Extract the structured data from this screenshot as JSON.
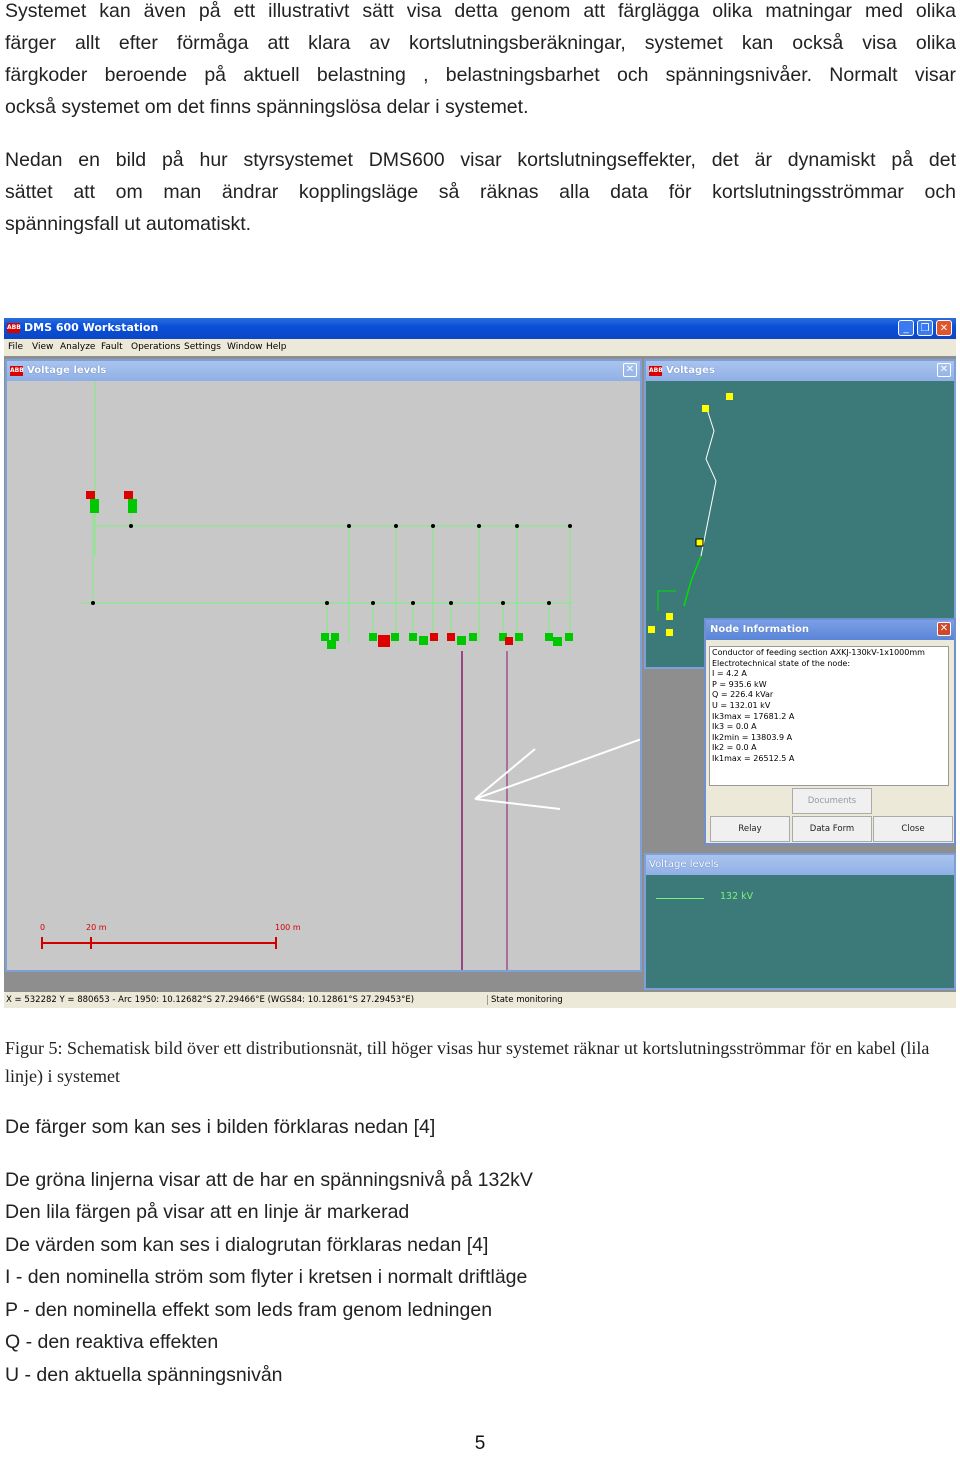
{
  "paragraphs": {
    "p1": [
      "Systemet kan även på ett illustrativt sätt visa detta genom att färglägga olika matningar med olika",
      "färger allt efter förmåga att klara av kortslutningsberäkningar, systemet kan också visa olika",
      "färgkoder beroende på aktuell belastning , belastningsbarhet och spänningsnivåer. Normalt visar",
      "också systemet om det finns spänningslösa delar i systemet."
    ],
    "p2": [
      "Nedan en bild på hur styrsystemet DMS600 visar kortslutningseffekter, det är dynamiskt på det",
      "sättet att om man ändrar kopplingsläge så räknas alla data för kortslutningsströmmar och",
      "spänningsfall ut automatiskt."
    ]
  },
  "screenshot": {
    "app_title": "DMS 600 Workstation",
    "logo": "ABB",
    "menu": [
      "File",
      "View",
      "Analyze",
      "Fault",
      "Operations",
      "Settings",
      "Window",
      "Help"
    ],
    "voltage_window": {
      "title": "Voltage levels",
      "scale_labels": [
        "0",
        "20 m",
        "100 m"
      ]
    },
    "voltages_window": {
      "title": "Voltages"
    },
    "node_info": {
      "title": "Node Information",
      "lines": [
        "Conductor of feeding section AXKJ-130kV-1x1000mm",
        "Electrotechnical state of the node:",
        "I =    4.2 A",
        "P  =   935.6 kW",
        "Q  =   226.4 kVar",
        "U  =   132.01 kV",
        "Ik3max = 17681.2 A",
        "Ik3 = 0.0 A",
        "Ik2min = 13803.9 A",
        "Ik2 = 0.0 A",
        "Ik1max = 26512.5 A"
      ],
      "buttons": {
        "documents": "Documents",
        "relay": "Relay",
        "data_form": "Data Form",
        "close": "Close"
      }
    },
    "legend_window": {
      "title": "Voltage levels",
      "entry": "132 kV"
    },
    "status": {
      "coords": "X = 532282  Y = 880653 - Arc 1950: 10.12682°S 27.29466°E (WGS84: 10.12861°S 27.29453°E)",
      "mode": "State monitoring"
    },
    "colors": {
      "line_green": "#7cf07c",
      "line_purple": "#8a1a6a",
      "switch_red": "#dd0000",
      "switch_green": "#00c800",
      "map_bg": "#3b7a78"
    }
  },
  "caption": "Figur 5: Schematisk bild över ett distributionsnät, till höger visas hur systemet räknar ut kortslutningsströmmar för en kabel (lila linje) i systemet",
  "lines": [
    "De färger som kan ses i bilden förklaras nedan [4]",
    "De gröna linjerna visar att de har en spänningsnivå på 132kV",
    "Den lila färgen på visar att en linje är markerad",
    "De värden som kan ses i dialogrutan förklaras nedan [4]",
    "I - den nominella ström som flyter i kretsen i normalt driftläge",
    "P - den nominella effekt som leds fram genom ledningen",
    "Q - den reaktiva effekten",
    "U - den aktuella spänningsnivån"
  ],
  "page_number": "5"
}
